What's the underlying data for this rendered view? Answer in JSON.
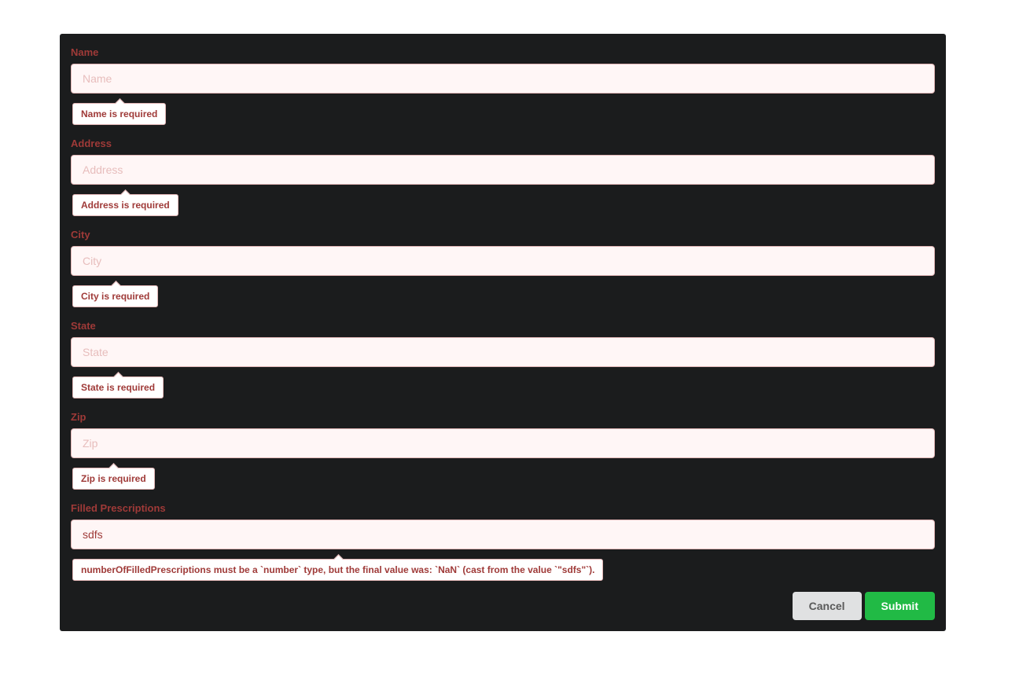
{
  "form": {
    "fields": [
      {
        "label": "Name",
        "placeholder": "Name",
        "value": "",
        "error": "Name is required"
      },
      {
        "label": "Address",
        "placeholder": "Address",
        "value": "",
        "error": "Address is required"
      },
      {
        "label": "City",
        "placeholder": "City",
        "value": "",
        "error": "City is required"
      },
      {
        "label": "State",
        "placeholder": "State",
        "value": "",
        "error": "State is required"
      },
      {
        "label": "Zip",
        "placeholder": "Zip",
        "value": "",
        "error": "Zip is required"
      },
      {
        "label": "Filled Prescriptions",
        "placeholder": "",
        "value": "sdfs",
        "error": "numberOfFilledPrescriptions must be a `number` type, but the final value was: `NaN` (cast from the value `\"sdfs\"`)."
      }
    ],
    "actions": {
      "cancel_label": "Cancel",
      "submit_label": "Submit"
    }
  },
  "colors": {
    "panel_background": "#1b1c1d",
    "error_text": "#9f3a38",
    "error_input_background": "#fff6f6",
    "error_border": "#e0b4b4",
    "submit_button": "#21ba45",
    "cancel_button": "#e0e1e2"
  }
}
